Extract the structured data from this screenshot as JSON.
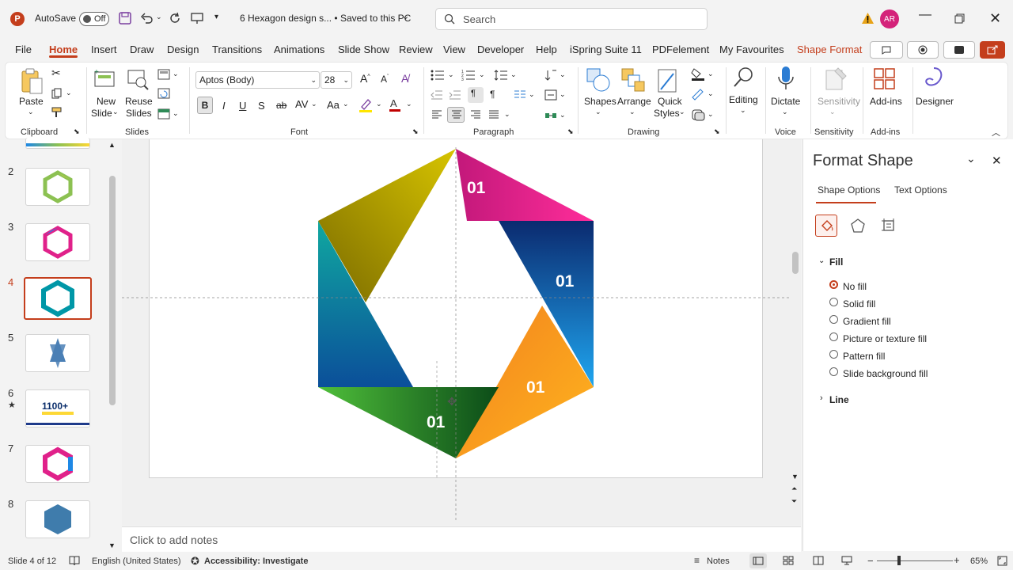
{
  "titlebar": {
    "autosave_label": "AutoSave",
    "autosave_state": "Off",
    "doc_title": "6 Hexagon design s... • Saved to this PC",
    "search_placeholder": "Search",
    "user_initials": "AR",
    "accent": "#c43e1c",
    "avatar_color": "#d4237a"
  },
  "menu": {
    "items": [
      "File",
      "Home",
      "Insert",
      "Draw",
      "Design",
      "Transitions",
      "Animations",
      "Slide Show",
      "Review",
      "View",
      "Developer",
      "Help",
      "iSpring Suite 11",
      "PDFelement",
      "My Favourites",
      "Shape Format"
    ],
    "active": "Home"
  },
  "ribbon": {
    "clipboard": {
      "paste": "Paste",
      "label": "Clipboard"
    },
    "slides": {
      "new_slide": "New",
      "new_slide2": "Slide",
      "reuse": "Reuse",
      "reuse2": "Slides",
      "label": "Slides"
    },
    "font": {
      "family": "Aptos (Body)",
      "size": "28",
      "bold": "B",
      "italic": "I",
      "underline": "U",
      "shadow": "S",
      "strike": "ab",
      "spacing": "AV",
      "case": "Aa",
      "label": "Font"
    },
    "paragraph": {
      "label": "Paragraph"
    },
    "drawing": {
      "shapes": "Shapes",
      "arrange": "Arrange",
      "quick": "Quick",
      "styles": "Styles",
      "label": "Drawing"
    },
    "editing": {
      "label": "Editing"
    },
    "voice": {
      "dictate": "Dictate",
      "label": "Voice"
    },
    "sensitivity": {
      "btn": "Sensitivity",
      "label": "Sensitivity"
    },
    "addins": {
      "btn": "Add-ins",
      "label": "Add-ins"
    },
    "designer": {
      "btn": "Designer"
    }
  },
  "slides_panel": {
    "numbers": [
      "2",
      "3",
      "4",
      "5",
      "6",
      "7",
      "8"
    ],
    "active": "4",
    "star_on": "6",
    "thumb6_text": "1100+"
  },
  "slide": {
    "labels": [
      "01",
      "01",
      "01",
      "01"
    ],
    "segment_colors": [
      "#e0218a",
      "#1565c0",
      "#f7a21b",
      "#1f8a2e",
      "#0097a7",
      "#c0a800"
    ]
  },
  "notes_placeholder": "Click to add notes",
  "format_pane": {
    "title": "Format Shape",
    "tabs": [
      "Shape Options",
      "Text Options"
    ],
    "section_fill": "Fill",
    "fill_options": [
      "No fill",
      "Solid fill",
      "Gradient fill",
      "Picture or texture fill",
      "Pattern fill",
      "Slide background fill"
    ],
    "selected_fill": "No fill",
    "section_line": "Line"
  },
  "status": {
    "slide_info": "Slide 4 of 12",
    "language": "English (United States)",
    "accessibility": "Accessibility: Investigate",
    "notes": "Notes",
    "zoom": "65%"
  }
}
